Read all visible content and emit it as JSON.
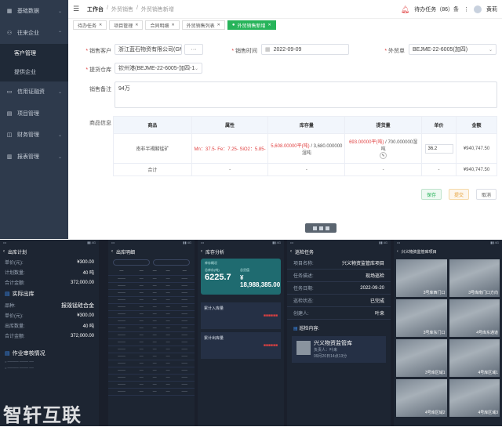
{
  "sidebar": {
    "items": [
      {
        "label": "基础数据",
        "icon": "grid-icon"
      },
      {
        "label": "往来企业",
        "icon": "users-icon"
      },
      {
        "label": "信用证融资",
        "icon": "card-icon"
      },
      {
        "label": "项目管理",
        "icon": "folder-icon"
      },
      {
        "label": "财务管理",
        "icon": "wallet-icon"
      },
      {
        "label": "报表管理",
        "icon": "report-icon"
      }
    ],
    "subitems": [
      {
        "label": "客户管理"
      },
      {
        "label": "提供企业"
      }
    ]
  },
  "header": {
    "workbench": "工作台",
    "crumb1": "外贸销售",
    "crumb2": "外贸销售新增",
    "tasks": "待办任务（86）条",
    "user": "黄莉"
  },
  "tabs": [
    {
      "label": "待办任务"
    },
    {
      "label": "项目管理"
    },
    {
      "label": "合同明细"
    },
    {
      "label": "外贸销售列表"
    },
    {
      "label": "外贸销售新增"
    }
  ],
  "form": {
    "customer_label": "销售客户",
    "customer_value": "浙江蓝石物资有限公司(GM",
    "customer_more": "···",
    "time_label": "销售时间",
    "time_value": "2022-09-09",
    "order_label": "外贸单",
    "order_value": "BEJME-22-6005(加四)",
    "warehouse_label": "提货仓库",
    "warehouse_value": "钦州港(BEJME-22-6005-加四-1",
    "remark_label": "销售备注",
    "remark_value": "94万",
    "goods_label": "商品信息"
  },
  "goods_table": {
    "headers": [
      "商品",
      "属性",
      "库存量",
      "提货量",
      "单价",
      "金额"
    ],
    "row": {
      "product": "南非半褐酸锰矿",
      "attribute": "Mn：37.5- Fe：7.25- SiO2：5.85-",
      "stock_red": "5,608.00000平(吨)",
      "stock_rest": "/ 3,680.000000湿吨",
      "pickup_red": "693.00000平(吨)",
      "pickup_rest": "/ 700.000000湿吨",
      "price": "36.2",
      "amount": "¥940,747.50"
    },
    "total": {
      "label": "合计",
      "attr": "-",
      "stock": "-",
      "pickup": "-",
      "price": "-",
      "amount": "¥940,747.50"
    }
  },
  "buttons": {
    "save": "保存",
    "submit": "提交",
    "cancel": "取消"
  },
  "phone1": {
    "title": "出库计划",
    "rows1": [
      {
        "k": "单价(元):",
        "v": "¥300.00"
      },
      {
        "k": "计划数量:",
        "v": "40 吨"
      },
      {
        "k": "合计金额:",
        "v": "372,000.00"
      }
    ],
    "section": "实际出库",
    "rows2": [
      {
        "k": "品种:",
        "v": "报毁锰硅合金"
      },
      {
        "k": "单价(元):",
        "v": "¥300.00"
      },
      {
        "k": "出库数量:",
        "v": "40 吨"
      },
      {
        "k": "合计金额:",
        "v": "372,000.00"
      }
    ],
    "log_title": "作业审核情况"
  },
  "phone2": {
    "title": "出库明细"
  },
  "phone3": {
    "title": "库存分析",
    "card_label": "库存概况",
    "kpi1": "6225.7",
    "kpi2": "¥ 18,988,385.00",
    "kpi1_label": "总库存(吨)",
    "kpi2_label": "总货值",
    "block1": "累计入库量",
    "block2": "累计出库量"
  },
  "phone4": {
    "title": "巡检任务",
    "rows": [
      {
        "k": "项目名称:",
        "v": "兴义物资监管库项目"
      },
      {
        "k": "任务描述:",
        "v": "现场巡检"
      },
      {
        "k": "任务日期:",
        "v": "2022-09-20"
      },
      {
        "k": "巡检状态:",
        "v": "已完成"
      },
      {
        "k": "创建人:",
        "v": "叶来"
      }
    ],
    "content_label": "巡检内容:",
    "store": "兴义物资监管库",
    "person": "负责人：叶来",
    "time": "09月20日14点13分"
  },
  "phone5": {
    "title": "兴义物资监管库项目",
    "cams": [
      {
        "label": "3号库西门口"
      },
      {
        "label": "3号库南门口方向"
      },
      {
        "label": "3号库东门口"
      },
      {
        "label": "4号库东通道"
      },
      {
        "label": "3号库区域1"
      },
      {
        "label": "4号库区域1"
      },
      {
        "label": "4号库区域2"
      },
      {
        "label": "4号库区域3"
      }
    ]
  },
  "watermark": "智轩互联"
}
